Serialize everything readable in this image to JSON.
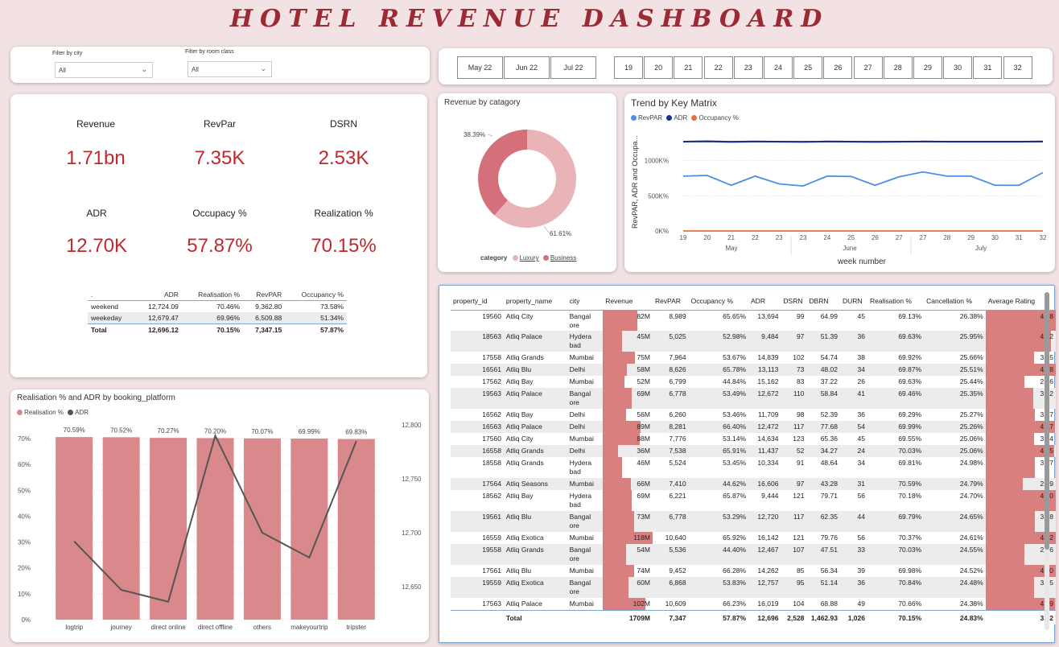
{
  "title": "HOTEL REVENUE DASHBOARD",
  "filters": {
    "city_label": "Filter by city",
    "city_value": "All",
    "room_label": "Filter by room class",
    "room_value": "All"
  },
  "months": [
    "May 22",
    "Jun 22",
    "Jul 22"
  ],
  "weeks": [
    "19",
    "20",
    "21",
    "22",
    "23",
    "24",
    "25",
    "26",
    "27",
    "28",
    "29",
    "30",
    "31",
    "32"
  ],
  "kpis": [
    {
      "label": "Revenue",
      "value": "1.71bn"
    },
    {
      "label": "RevPar",
      "value": "7.35K"
    },
    {
      "label": "DSRN",
      "value": "2.53K"
    },
    {
      "label": "ADR",
      "value": "12.70K"
    },
    {
      "label": "Occupacy %",
      "value": "57.87%"
    },
    {
      "label": "Realization %",
      "value": "70.15%"
    }
  ],
  "summary_table": {
    "headers": [
      ".",
      "ADR",
      "Realisation %",
      "RevPAR",
      "Occupancy %"
    ],
    "rows": [
      [
        "weekend",
        "12,724.09",
        "70.46%",
        "9,362.80",
        "73.58%"
      ],
      [
        "weekeday",
        "12,679.47",
        "69.96%",
        "6,509.88",
        "51.34%"
      ]
    ],
    "total": [
      "Total",
      "12,696.12",
      "70.15%",
      "7,347.15",
      "57.87%"
    ]
  },
  "colors": {
    "accent": "#c0282e",
    "title": "#9b2a32",
    "bar": "#d9888c",
    "luxury": "#e8b4b8",
    "business": "#d4707a",
    "revpar": "#4a8fe8",
    "adr": "#1a2f8f",
    "occupancy": "#e8703a"
  },
  "donut": {
    "title": "Revenue by catagory",
    "legend_title": "category",
    "series": [
      "Luxury",
      "Business"
    ],
    "label_business": "38.39%",
    "label_luxury": "61.61%"
  },
  "trend": {
    "title": "Trend by Key Matrix",
    "legend": [
      "RevPAR",
      "ADR",
      "Occupancy %"
    ],
    "ylabel": "RevPAR, ADR and Occupa...",
    "xlabel": "week number",
    "yticks": [
      "1000K%",
      "500K%",
      "0K%"
    ],
    "xticks": [
      "19",
      "20",
      "21",
      "22",
      "23",
      "23",
      "24",
      "25",
      "26",
      "27",
      "27",
      "28",
      "29",
      "30",
      "31",
      "32"
    ],
    "month_labels": [
      "May",
      "June",
      "July"
    ]
  },
  "platform": {
    "title": "Realisation % and ADR by booking_platform",
    "legend": [
      "Realisation %",
      "ADR"
    ],
    "left_ticks": [
      "70%",
      "60%",
      "50%",
      "40%",
      "30%",
      "20%",
      "10%",
      "0%"
    ],
    "right_ticks": [
      "12,800",
      "12,750",
      "12,700",
      "12,650"
    ]
  },
  "chart_data": [
    {
      "type": "pie",
      "title": "Revenue by catagory",
      "categories": [
        "Luxury",
        "Business"
      ],
      "values": [
        61.61,
        38.39
      ]
    },
    {
      "type": "line",
      "title": "Trend by Key Matrix",
      "xlabel": "week number",
      "ylabel": "RevPAR, ADR and Occupa...",
      "x": [
        "19",
        "20",
        "21",
        "22",
        "23",
        "23",
        "24",
        "25",
        "26",
        "27",
        "27",
        "28",
        "29",
        "30",
        "31",
        "32"
      ],
      "ylim": [
        0,
        1500
      ],
      "series": [
        {
          "name": "RevPAR",
          "values": [
            780,
            790,
            650,
            780,
            670,
            640,
            780,
            775,
            650,
            770,
            840,
            780,
            780,
            650,
            650,
            830
          ]
        },
        {
          "name": "ADR",
          "values": [
            1270,
            1275,
            1268,
            1272,
            1270,
            1268,
            1272,
            1270,
            1268,
            1270,
            1272,
            1270,
            1270,
            1270,
            1270,
            1272
          ]
        },
        {
          "name": "Occupancy %",
          "values": [
            0,
            0,
            0,
            0,
            0,
            0,
            0,
            0,
            0,
            0,
            0,
            0,
            0,
            0,
            0,
            0
          ]
        }
      ]
    },
    {
      "type": "bar",
      "title": "Realisation % and ADR by booking_platform",
      "categories": [
        "logtrip",
        "journey",
        "direct online",
        "direct offline",
        "others",
        "makeyourtrip",
        "tripster"
      ],
      "series": [
        {
          "name": "Realisation %",
          "values": [
            70.59,
            70.52,
            70.27,
            70.2,
            70.07,
            69.99,
            69.83
          ],
          "labels": [
            "70.59%",
            "70.52%",
            "70.27%",
            "70.20%",
            "70.07%",
            "69.99%",
            "69.83%"
          ]
        },
        {
          "name": "ADR",
          "values": [
            12692,
            12647,
            12636,
            12790,
            12700,
            12677,
            12785
          ]
        }
      ],
      "ylim": [
        0,
        72
      ],
      "y2lim": [
        12630,
        12810
      ]
    }
  ],
  "property_table": {
    "headers": [
      "property_id",
      "property_name",
      "city",
      "Revenue",
      "RevPAR",
      "Occupancy %",
      "ADR",
      "DSRN",
      "DBRN",
      "DURN",
      "Realisation %",
      "Cancellation %",
      "Average Rating"
    ],
    "rows": [
      {
        "id": "19560",
        "name": "Atliq City",
        "city": "Bangalore",
        "rev": "82M",
        "revf": 0.69,
        "revpar": "8,989",
        "occ": "65.65%",
        "adr": "13,694",
        "dsrn": "99",
        "dbrn": "64.99",
        "durn": "45",
        "real": "69.13%",
        "canc": "26.38%",
        "rating": "4.28",
        "ratf": 1.0
      },
      {
        "id": "18563",
        "name": "Atliq Palace",
        "city": "Hyderabad",
        "rev": "45M",
        "revf": 0.38,
        "revpar": "5,025",
        "occ": "52.98%",
        "adr": "9,484",
        "dsrn": "97",
        "dbrn": "51.39",
        "durn": "36",
        "real": "69.63%",
        "canc": "25.95%",
        "rating": "4.22",
        "ratf": 0.93
      },
      {
        "id": "17558",
        "name": "Atliq Grands",
        "city": "Mumbai",
        "rev": "75M",
        "revf": 0.64,
        "revpar": "7,964",
        "occ": "53.67%",
        "adr": "14,839",
        "dsrn": "102",
        "dbrn": "54.74",
        "durn": "38",
        "real": "69.92%",
        "canc": "25.66%",
        "rating": "3.05",
        "ratf": 0.69
      },
      {
        "id": "16561",
        "name": "Atliq Blu",
        "city": "Delhi",
        "rev": "58M",
        "revf": 0.49,
        "revpar": "8,626",
        "occ": "65.78%",
        "adr": "13,113",
        "dsrn": "73",
        "dbrn": "48.02",
        "durn": "34",
        "real": "69.87%",
        "canc": "25.51%",
        "rating": "4.28",
        "ratf": 1.0
      },
      {
        "id": "17562",
        "name": "Atliq Bay",
        "city": "Mumbai",
        "rev": "52M",
        "revf": 0.44,
        "revpar": "6,799",
        "occ": "44.84%",
        "adr": "15,162",
        "dsrn": "83",
        "dbrn": "37.22",
        "durn": "26",
        "real": "69.63%",
        "canc": "25.44%",
        "rating": "2.36",
        "ratf": 0.55
      },
      {
        "id": "19563",
        "name": "Atliq Palace",
        "city": "Bangalore",
        "rev": "69M",
        "revf": 0.58,
        "revpar": "6,778",
        "occ": "53.49%",
        "adr": "12,672",
        "dsrn": "110",
        "dbrn": "58.84",
        "durn": "41",
        "real": "69.46%",
        "canc": "25.35%",
        "rating": "3.02",
        "ratf": 0.68
      },
      {
        "id": "16562",
        "name": "Atliq Bay",
        "city": "Delhi",
        "rev": "56M",
        "revf": 0.47,
        "revpar": "6,260",
        "occ": "53.46%",
        "adr": "11,709",
        "dsrn": "98",
        "dbrn": "52.39",
        "durn": "36",
        "real": "69.29%",
        "canc": "25.27%",
        "rating": "3.07",
        "ratf": 0.7
      },
      {
        "id": "16563",
        "name": "Atliq Palace",
        "city": "Delhi",
        "rev": "89M",
        "revf": 0.75,
        "revpar": "8,281",
        "occ": "66.40%",
        "adr": "12,472",
        "dsrn": "117",
        "dbrn": "77.68",
        "durn": "54",
        "real": "69.99%",
        "canc": "25.26%",
        "rating": "4.27",
        "ratf": 0.99
      },
      {
        "id": "17560",
        "name": "Atliq City",
        "city": "Mumbai",
        "rev": "88M",
        "revf": 0.74,
        "revpar": "7,776",
        "occ": "53.14%",
        "adr": "14,634",
        "dsrn": "123",
        "dbrn": "65.36",
        "durn": "45",
        "real": "69.55%",
        "canc": "25.06%",
        "rating": "3.04",
        "ratf": 0.69
      },
      {
        "id": "16558",
        "name": "Atliq Grands",
        "city": "Delhi",
        "rev": "36M",
        "revf": 0.3,
        "revpar": "7,538",
        "occ": "65.91%",
        "adr": "11,437",
        "dsrn": "52",
        "dbrn": "34.27",
        "durn": "24",
        "real": "70.03%",
        "canc": "25.06%",
        "rating": "4.25",
        "ratf": 0.98
      },
      {
        "id": "18558",
        "name": "Atliq Grands",
        "city": "Hyderabad",
        "rev": "46M",
        "revf": 0.39,
        "revpar": "5,524",
        "occ": "53.45%",
        "adr": "10,334",
        "dsrn": "91",
        "dbrn": "48.64",
        "durn": "34",
        "real": "69.81%",
        "canc": "24.98%",
        "rating": "3.07",
        "ratf": 0.7
      },
      {
        "id": "17564",
        "name": "Atliq Seasons",
        "city": "Mumbai",
        "rev": "66M",
        "revf": 0.56,
        "revpar": "7,410",
        "occ": "44.62%",
        "adr": "16,606",
        "dsrn": "97",
        "dbrn": "43.28",
        "durn": "31",
        "real": "70.59%",
        "canc": "24.79%",
        "rating": "2.29",
        "ratf": 0.53
      },
      {
        "id": "18562",
        "name": "Atliq Bay",
        "city": "Hyderabad",
        "rev": "69M",
        "revf": 0.58,
        "revpar": "6,221",
        "occ": "65.87%",
        "adr": "9,444",
        "dsrn": "121",
        "dbrn": "79.71",
        "durn": "56",
        "real": "70.18%",
        "canc": "24.70%",
        "rating": "4.30",
        "ratf": 1.0
      },
      {
        "id": "19561",
        "name": "Atliq Blu",
        "city": "Bangalore",
        "rev": "73M",
        "revf": 0.62,
        "revpar": "6,778",
        "occ": "53.29%",
        "adr": "12,720",
        "dsrn": "117",
        "dbrn": "62.35",
        "durn": "44",
        "real": "69.79%",
        "canc": "24.65%",
        "rating": "3.08",
        "ratf": 0.7
      },
      {
        "id": "16559",
        "name": "Atliq Exotica",
        "city": "Mumbai",
        "rev": "118M",
        "revf": 1.0,
        "revpar": "10,640",
        "occ": "65.92%",
        "adr": "16,142",
        "dsrn": "121",
        "dbrn": "79.76",
        "durn": "56",
        "real": "70.37%",
        "canc": "24.61%",
        "rating": "4.32",
        "ratf": 1.0
      },
      {
        "id": "19558",
        "name": "Atliq Grands",
        "city": "Bangalore",
        "rev": "54M",
        "revf": 0.46,
        "revpar": "5,536",
        "occ": "44.40%",
        "adr": "12,467",
        "dsrn": "107",
        "dbrn": "47.51",
        "durn": "33",
        "real": "70.03%",
        "canc": "24.55%",
        "rating": "2.36",
        "ratf": 0.55
      },
      {
        "id": "17561",
        "name": "Atliq Blu",
        "city": "Mumbai",
        "rev": "74M",
        "revf": 0.63,
        "revpar": "9,452",
        "occ": "66.28%",
        "adr": "14,262",
        "dsrn": "85",
        "dbrn": "56.34",
        "durn": "39",
        "real": "69.98%",
        "canc": "24.52%",
        "rating": "4.30",
        "ratf": 1.0
      },
      {
        "id": "19559",
        "name": "Atliq Exotica",
        "city": "Bangalore",
        "rev": "60M",
        "revf": 0.51,
        "revpar": "6,868",
        "occ": "53.83%",
        "adr": "12,757",
        "dsrn": "95",
        "dbrn": "51.14",
        "durn": "36",
        "real": "70.84%",
        "canc": "24.48%",
        "rating": "3.05",
        "ratf": 0.69
      },
      {
        "id": "17563",
        "name": "Atliq Palace",
        "city": "Mumbai",
        "rev": "102M",
        "revf": 0.86,
        "revpar": "10,609",
        "occ": "66.23%",
        "adr": "16,019",
        "dsrn": "104",
        "dbrn": "68.88",
        "durn": "49",
        "real": "70.66%",
        "canc": "24.38%",
        "rating": "4.29",
        "ratf": 0.99
      }
    ],
    "total": {
      "label": "Total",
      "rev": "1709M",
      "revpar": "7,347",
      "occ": "57.87%",
      "adr": "12,696",
      "dsrn": "2,528",
      "dbrn": "1,462.93",
      "durn": "1,026",
      "real": "70.15%",
      "canc": "24.83%",
      "rating": "3.62"
    }
  }
}
